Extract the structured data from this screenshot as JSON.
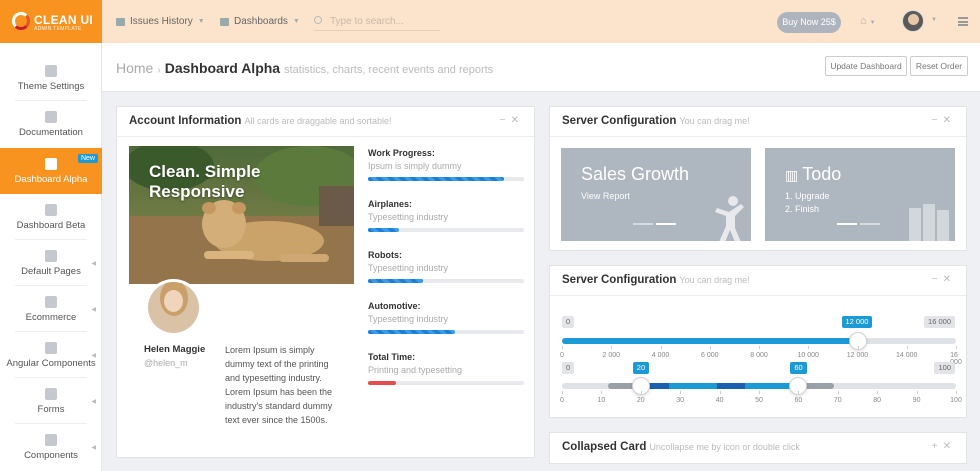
{
  "brand": {
    "name": "CLEAN UI",
    "tagline": "ADMIN TEMPLATE"
  },
  "topbar": {
    "nav": [
      {
        "label": "Issues History",
        "icon": "folder-icon"
      },
      {
        "label": "Dashboards",
        "icon": "grid-icon"
      }
    ],
    "search_placeholder": "Type to search...",
    "buy_label": "Buy Now 25$"
  },
  "sidebar": {
    "items": [
      {
        "label": "Theme Settings",
        "icon": "gear-icon",
        "active": false,
        "arrow": false
      },
      {
        "label": "Documentation",
        "icon": "book-icon",
        "active": false,
        "arrow": false
      },
      {
        "label": "Dashboard Alpha",
        "icon": "home-icon",
        "active": true,
        "arrow": false,
        "badge": "New"
      },
      {
        "label": "Dashboard Beta",
        "icon": "home-icon",
        "active": false,
        "arrow": false
      },
      {
        "label": "Default Pages",
        "icon": "page-icon",
        "active": false,
        "arrow": true
      },
      {
        "label": "Ecommerce",
        "icon": "cart-icon",
        "active": false,
        "arrow": true
      },
      {
        "label": "Angular Components",
        "icon": "rocket-icon",
        "active": false,
        "arrow": true
      },
      {
        "label": "Forms",
        "icon": "list-icon",
        "active": false,
        "arrow": true
      },
      {
        "label": "Components",
        "icon": "refresh-icon",
        "active": false,
        "arrow": true
      }
    ]
  },
  "page": {
    "breadcrumb_home": "Home",
    "title": "Dashboard Alpha",
    "subtitle": "statistics, charts, recent events and reports",
    "update_label": "Update Dashboard",
    "reset_label": "Reset Order"
  },
  "account_card": {
    "title": "Account Information",
    "subtitle": "All cards are draggable and sortable!",
    "photo_caption_line1": "Clean. Simple",
    "photo_caption_line2": "Responsive",
    "user_name": "Helen Maggie",
    "user_handle": "@helen_m",
    "bio": "Lorem Ipsum is simply dummy text of the printing and typesetting industry. Lorem Ipsum has been the industry's standard dummy text ever since the 1500s.",
    "progress": [
      {
        "title": "Work Progress:",
        "subtitle": "Ipsum is simply dummy",
        "value": 0.87,
        "color": "blue"
      },
      {
        "title": "Airplanes:",
        "subtitle": "Typesetting industry",
        "value": 0.2,
        "color": "blue"
      },
      {
        "title": "Robots:",
        "subtitle": "Typesetting industry",
        "value": 0.35,
        "color": "blue"
      },
      {
        "title": "Automotive:",
        "subtitle": "Typesetting industry",
        "value": 0.56,
        "color": "blue"
      },
      {
        "title": "Total Time:",
        "subtitle": "Printing and typesetting",
        "value": 0.18,
        "color": "red"
      }
    ]
  },
  "server_card_1": {
    "title": "Server Configuration",
    "subtitle": "You can drag me!",
    "tiles": [
      {
        "title": "Sales Growth",
        "lines": [
          "View Report"
        ]
      },
      {
        "title": "Todo",
        "lines": [
          "1. Upgrade",
          "2. Finish"
        ]
      }
    ]
  },
  "server_card_2": {
    "title": "Server Configuration",
    "subtitle": "You can drag me!",
    "slider1": {
      "min_label": "0",
      "max_label": "16 000",
      "value_label": "12 000",
      "value": 12000,
      "min": 0,
      "max": 16000,
      "ticks": [
        "0",
        "2 000",
        "4 000",
        "6 000",
        "8 000",
        "10 000",
        "12 000",
        "14 000",
        "16 000"
      ]
    },
    "slider2": {
      "min_label": "0",
      "max_label": "100",
      "from_label": "20",
      "to_label": "60",
      "from": 20,
      "to": 60,
      "min": 0,
      "max": 100,
      "ticks": [
        "0",
        "10",
        "20",
        "30",
        "40",
        "50",
        "60",
        "70",
        "80",
        "90",
        "100"
      ]
    }
  },
  "collapsed_card": {
    "title": "Collapsed Card",
    "subtitle": "Uncollapse me by icon or double click"
  },
  "colors": {
    "accent": "#f7931e",
    "topbar": "#fce4cc",
    "blue": "#1b9ad6",
    "tile": "#aeb6bf"
  }
}
